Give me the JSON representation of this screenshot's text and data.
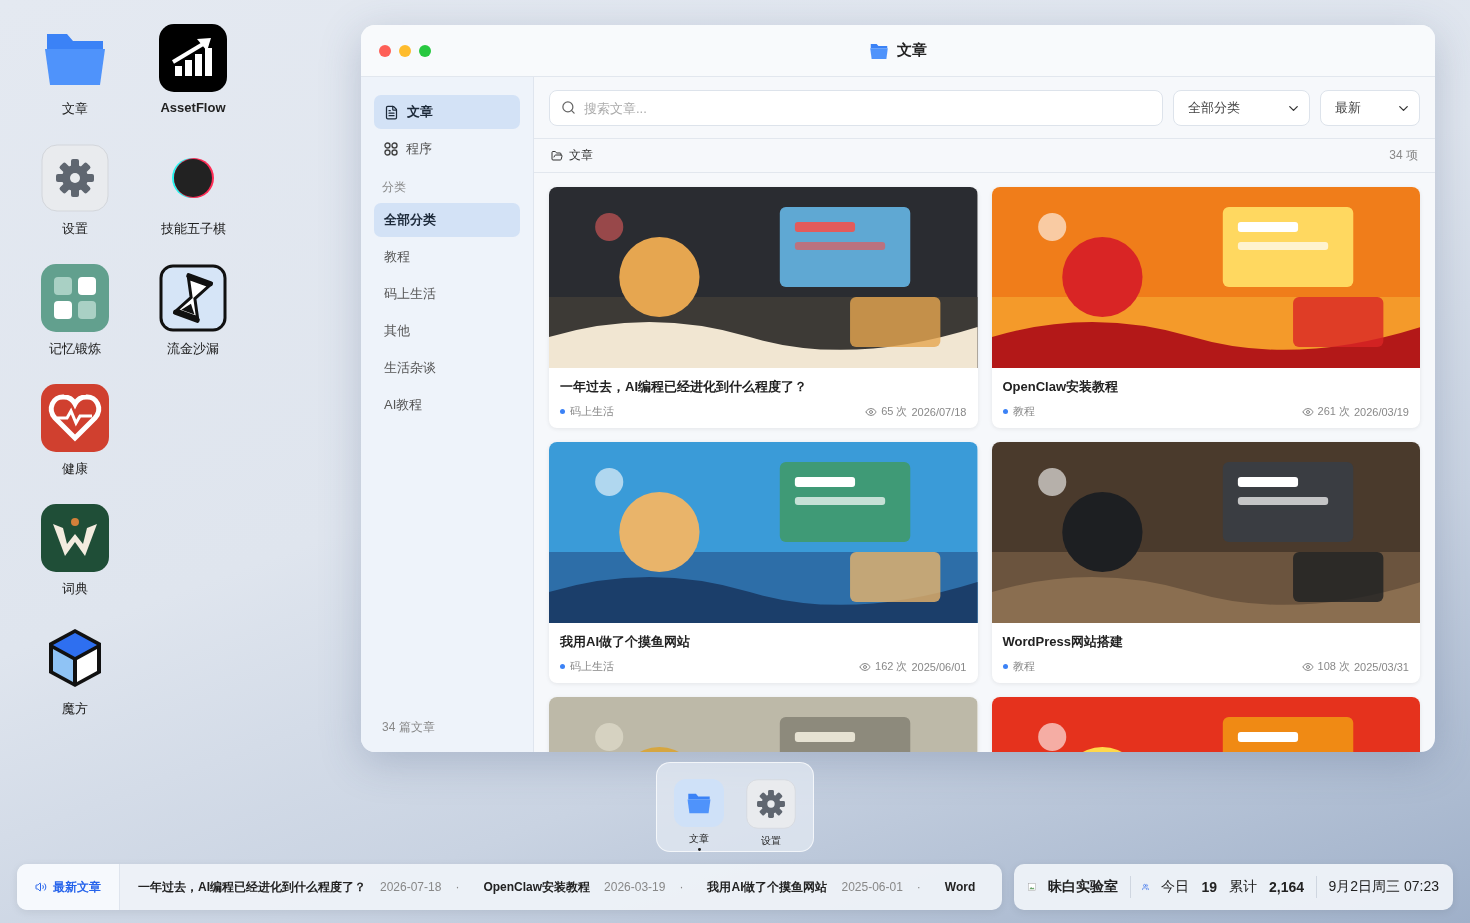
{
  "desktop": {
    "columns": [
      [
        {
          "label": "文章",
          "kind": "folder"
        },
        {
          "label": "设置",
          "kind": "settings"
        },
        {
          "label": "记忆锻炼",
          "kind": "memory"
        },
        {
          "label": "健康",
          "kind": "health"
        },
        {
          "label": "词典",
          "kind": "dictionary"
        },
        {
          "label": "魔方",
          "kind": "cube"
        }
      ],
      [
        {
          "label": "AssetFlow",
          "kind": "assetflow"
        },
        {
          "label": "技能五子棋",
          "kind": "gomoku"
        },
        {
          "label": "流金沙漏",
          "kind": "hourglass"
        }
      ]
    ]
  },
  "window": {
    "title": "文章",
    "sidebar": {
      "nav": [
        {
          "label": "文章",
          "kind": "doc",
          "selected": true
        },
        {
          "label": "程序",
          "kind": "apps",
          "selected": false
        }
      ],
      "section_label": "分类",
      "categories": [
        {
          "label": "全部分类",
          "selected": true
        },
        {
          "label": "教程",
          "selected": false
        },
        {
          "label": "码上生活",
          "selected": false
        },
        {
          "label": "其他",
          "selected": false
        },
        {
          "label": "生活杂谈",
          "selected": false
        },
        {
          "label": "AI教程",
          "selected": false
        }
      ],
      "footer": "34 篇文章"
    },
    "toolbar": {
      "search": {
        "placeholder": "搜索文章..."
      },
      "selects": [
        {
          "value": "全部分类"
        },
        {
          "value": "最新"
        }
      ]
    },
    "breadcrumb": {
      "label": "文章",
      "count": "34 项"
    },
    "cards": [
      {
        "title": "一年过去，AI编程已经进化到什么程度了？",
        "category": "码上生活",
        "views": "65 次",
        "date": "2026/07/18"
      },
      {
        "title": "OpenClaw安装教程",
        "category": "教程",
        "views": "261 次",
        "date": "2026/03/19"
      },
      {
        "title": "我用AI做了个摸鱼网站",
        "category": "码上生活",
        "views": "162 次",
        "date": "2025/06/01"
      },
      {
        "title": "WordPress网站搭建",
        "category": "教程",
        "views": "108 次",
        "date": "2025/03/31"
      },
      {
        "kind": "picture"
      },
      {
        "kind": "picture"
      }
    ]
  },
  "dock": [
    {
      "label": "文章",
      "kind": "folder",
      "running": true
    },
    {
      "label": "设置",
      "kind": "settings",
      "running": false
    }
  ],
  "ticker": {
    "label": "最新文章",
    "separator": "·",
    "items": [
      {
        "title": "一年过去，AI编程已经进化到什么程度了？",
        "date": "2026-07-18"
      },
      {
        "title": "OpenClaw安装教程",
        "date": "2026-03-19"
      },
      {
        "title": "我用AI做了个摸鱼网站",
        "date": "2025-06-01"
      },
      {
        "title": "Word"
      }
    ]
  },
  "status": {
    "site": "昧白实验室",
    "today_label": "今日",
    "today": "19",
    "total_label": "累计",
    "total": "2,164",
    "datetime": "9月2日周三 07:23"
  }
}
